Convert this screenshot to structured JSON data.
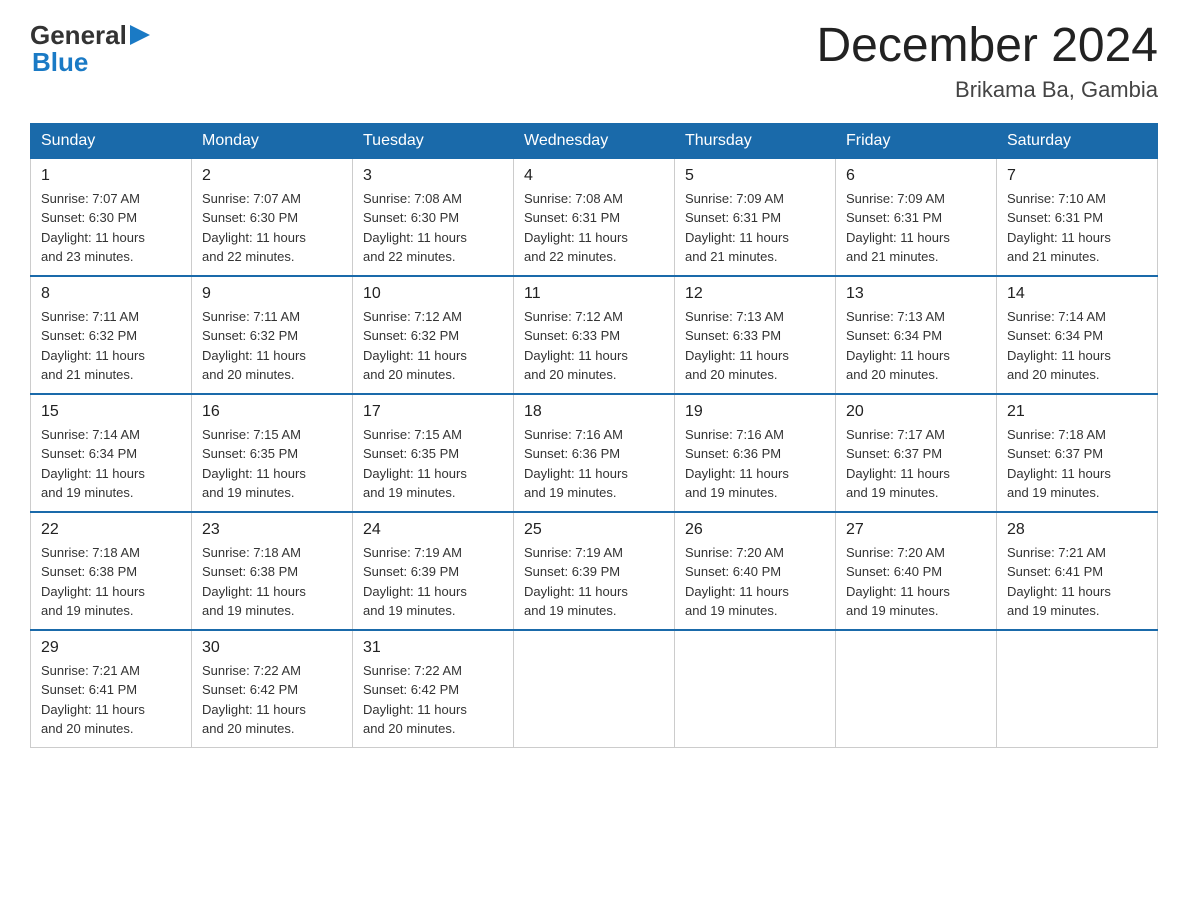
{
  "header": {
    "title": "December 2024",
    "location": "Brikama Ba, Gambia"
  },
  "logo": {
    "general": "General",
    "blue": "Blue"
  },
  "days_of_week": [
    "Sunday",
    "Monday",
    "Tuesday",
    "Wednesday",
    "Thursday",
    "Friday",
    "Saturday"
  ],
  "weeks": [
    [
      {
        "day": "1",
        "sunrise": "7:07 AM",
        "sunset": "6:30 PM",
        "daylight": "11 hours and 23 minutes."
      },
      {
        "day": "2",
        "sunrise": "7:07 AM",
        "sunset": "6:30 PM",
        "daylight": "11 hours and 22 minutes."
      },
      {
        "day": "3",
        "sunrise": "7:08 AM",
        "sunset": "6:30 PM",
        "daylight": "11 hours and 22 minutes."
      },
      {
        "day": "4",
        "sunrise": "7:08 AM",
        "sunset": "6:31 PM",
        "daylight": "11 hours and 22 minutes."
      },
      {
        "day": "5",
        "sunrise": "7:09 AM",
        "sunset": "6:31 PM",
        "daylight": "11 hours and 21 minutes."
      },
      {
        "day": "6",
        "sunrise": "7:09 AM",
        "sunset": "6:31 PM",
        "daylight": "11 hours and 21 minutes."
      },
      {
        "day": "7",
        "sunrise": "7:10 AM",
        "sunset": "6:31 PM",
        "daylight": "11 hours and 21 minutes."
      }
    ],
    [
      {
        "day": "8",
        "sunrise": "7:11 AM",
        "sunset": "6:32 PM",
        "daylight": "11 hours and 21 minutes."
      },
      {
        "day": "9",
        "sunrise": "7:11 AM",
        "sunset": "6:32 PM",
        "daylight": "11 hours and 20 minutes."
      },
      {
        "day": "10",
        "sunrise": "7:12 AM",
        "sunset": "6:32 PM",
        "daylight": "11 hours and 20 minutes."
      },
      {
        "day": "11",
        "sunrise": "7:12 AM",
        "sunset": "6:33 PM",
        "daylight": "11 hours and 20 minutes."
      },
      {
        "day": "12",
        "sunrise": "7:13 AM",
        "sunset": "6:33 PM",
        "daylight": "11 hours and 20 minutes."
      },
      {
        "day": "13",
        "sunrise": "7:13 AM",
        "sunset": "6:34 PM",
        "daylight": "11 hours and 20 minutes."
      },
      {
        "day": "14",
        "sunrise": "7:14 AM",
        "sunset": "6:34 PM",
        "daylight": "11 hours and 20 minutes."
      }
    ],
    [
      {
        "day": "15",
        "sunrise": "7:14 AM",
        "sunset": "6:34 PM",
        "daylight": "11 hours and 19 minutes."
      },
      {
        "day": "16",
        "sunrise": "7:15 AM",
        "sunset": "6:35 PM",
        "daylight": "11 hours and 19 minutes."
      },
      {
        "day": "17",
        "sunrise": "7:15 AM",
        "sunset": "6:35 PM",
        "daylight": "11 hours and 19 minutes."
      },
      {
        "day": "18",
        "sunrise": "7:16 AM",
        "sunset": "6:36 PM",
        "daylight": "11 hours and 19 minutes."
      },
      {
        "day": "19",
        "sunrise": "7:16 AM",
        "sunset": "6:36 PM",
        "daylight": "11 hours and 19 minutes."
      },
      {
        "day": "20",
        "sunrise": "7:17 AM",
        "sunset": "6:37 PM",
        "daylight": "11 hours and 19 minutes."
      },
      {
        "day": "21",
        "sunrise": "7:18 AM",
        "sunset": "6:37 PM",
        "daylight": "11 hours and 19 minutes."
      }
    ],
    [
      {
        "day": "22",
        "sunrise": "7:18 AM",
        "sunset": "6:38 PM",
        "daylight": "11 hours and 19 minutes."
      },
      {
        "day": "23",
        "sunrise": "7:18 AM",
        "sunset": "6:38 PM",
        "daylight": "11 hours and 19 minutes."
      },
      {
        "day": "24",
        "sunrise": "7:19 AM",
        "sunset": "6:39 PM",
        "daylight": "11 hours and 19 minutes."
      },
      {
        "day": "25",
        "sunrise": "7:19 AM",
        "sunset": "6:39 PM",
        "daylight": "11 hours and 19 minutes."
      },
      {
        "day": "26",
        "sunrise": "7:20 AM",
        "sunset": "6:40 PM",
        "daylight": "11 hours and 19 minutes."
      },
      {
        "day": "27",
        "sunrise": "7:20 AM",
        "sunset": "6:40 PM",
        "daylight": "11 hours and 19 minutes."
      },
      {
        "day": "28",
        "sunrise": "7:21 AM",
        "sunset": "6:41 PM",
        "daylight": "11 hours and 19 minutes."
      }
    ],
    [
      {
        "day": "29",
        "sunrise": "7:21 AM",
        "sunset": "6:41 PM",
        "daylight": "11 hours and 20 minutes."
      },
      {
        "day": "30",
        "sunrise": "7:22 AM",
        "sunset": "6:42 PM",
        "daylight": "11 hours and 20 minutes."
      },
      {
        "day": "31",
        "sunrise": "7:22 AM",
        "sunset": "6:42 PM",
        "daylight": "11 hours and 20 minutes."
      },
      null,
      null,
      null,
      null
    ]
  ],
  "labels": {
    "sunrise": "Sunrise:",
    "sunset": "Sunset:",
    "daylight": "Daylight:"
  }
}
